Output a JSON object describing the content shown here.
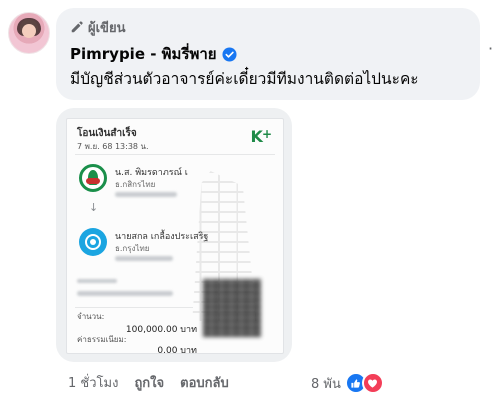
{
  "comment": {
    "author_badge": "ผู้เขียน",
    "author_name": "Pimrypie - พิมรี่พาย",
    "text": "มีบัญชีส่วนตัวอาจารย์ค่ะเดี๋ยวมีทีมงานติดต่อไปนะคะ",
    "more_label": "·"
  },
  "receipt": {
    "title": "โอนเงินสำเร็จ",
    "date": "7 พ.ย. 68 13:38 น.",
    "brand": "K",
    "brand_plus": "+",
    "sender_name": "น.ส. พิมรดาภรณ์ เ",
    "sender_bank": "ธ.กสิกรไทย",
    "receiver_name": "นายสกล เกลื้องประเสริฐ",
    "receiver_bank": "ธ.กรุงไทย",
    "amount_label": "จำนวน:",
    "amount_value": "100,000.00 บาท",
    "fee_label": "ค่าธรรมเนียม:",
    "fee_value": "0.00 บาท",
    "sender_bank_logo": "kbank-logo",
    "receiver_bank_logo": "ktb-logo"
  },
  "actions": {
    "time": "1 ชั่วโมง",
    "like": "ถูกใจ",
    "reply": "ตอบกลับ"
  },
  "reactions": {
    "count": "8 พัน",
    "types": [
      "like",
      "love"
    ]
  },
  "colors": {
    "bubble": "#f0f2f5",
    "verified": "#1877f2",
    "meta_text": "#65676b",
    "like": "#1877f2",
    "love": "#f33e58",
    "kbank_green": "#1a8f4a",
    "ktb_blue": "#1ba5e1"
  }
}
